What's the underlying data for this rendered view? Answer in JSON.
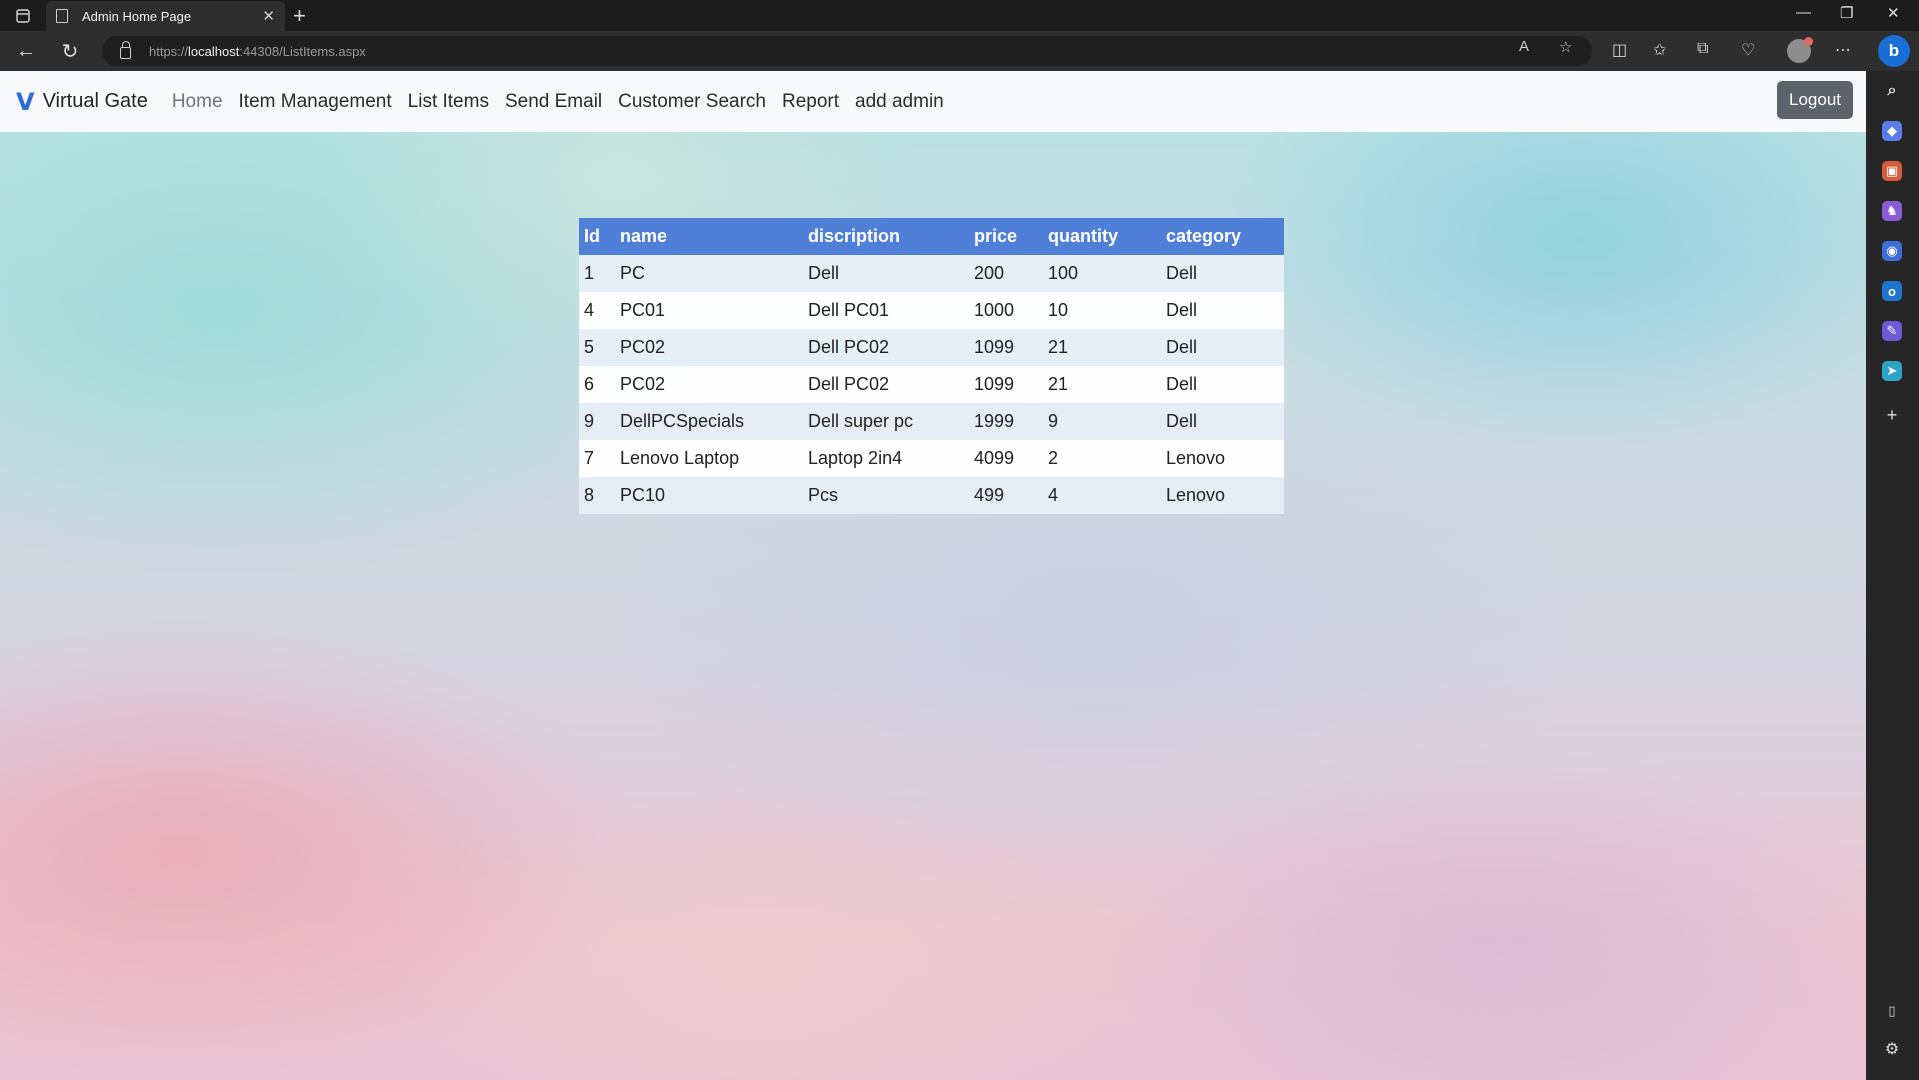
{
  "browser": {
    "tab_title": "Admin Home Page",
    "url_scheme": "https://",
    "url_host": "localhost",
    "url_rest": ":44308/ListItems.aspx"
  },
  "site": {
    "brand_logo": "V",
    "brand": "Virtual Gate",
    "nav": {
      "home": "Home",
      "item_management": "Item Management",
      "list_items": "List Items",
      "send_email": "Send Email",
      "customer_search": "Customer Search",
      "report": "Report",
      "add_admin": "add admin"
    },
    "logout": "Logout"
  },
  "table": {
    "headers": [
      "Id",
      "name",
      "discription",
      "price",
      "quantity",
      "category"
    ],
    "rows": [
      [
        "1",
        "PC",
        "Dell",
        "200",
        "100",
        "Dell"
      ],
      [
        "4",
        "PC01",
        "Dell PC01",
        "1000",
        "10",
        "Dell"
      ],
      [
        "5",
        "PC02",
        "Dell PC02",
        "1099",
        "21",
        "Dell"
      ],
      [
        "6",
        "PC02",
        "Dell PC02",
        "1099",
        "21",
        "Dell"
      ],
      [
        "9",
        "DellPCSpecials",
        "Dell super pc",
        "1999",
        "9",
        "Dell"
      ],
      [
        "7",
        "Lenovo Laptop",
        "Laptop 2in4",
        "4099",
        "2",
        "Lenovo"
      ],
      [
        "8",
        "PC10",
        "Pcs",
        "499",
        "4",
        "Lenovo"
      ]
    ]
  },
  "colors": {
    "header_bg": "#4f7fd6",
    "logout_bg": "#5c636a",
    "brand_accent": "#2e6bd9"
  }
}
